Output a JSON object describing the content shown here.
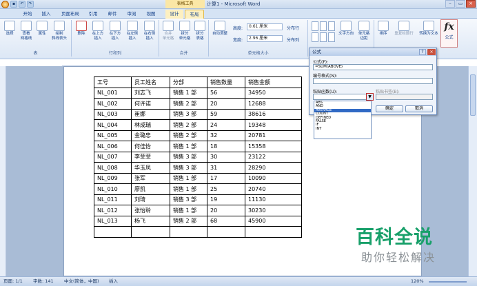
{
  "window": {
    "title": "计算1 - Microsoft Word",
    "context_tool": "表格工具"
  },
  "tabs": [
    "开始",
    "插入",
    "页面布局",
    "引用",
    "邮件",
    "审阅",
    "视图",
    "设计",
    "布局"
  ],
  "ribbon": {
    "buttons": {
      "select": "选择",
      "gridlines": "查看\n网格线",
      "properties": "属性",
      "draw_diagonal": "绘制\n斜线表头",
      "delete": "删除",
      "insert_above": "在上方\n插入",
      "insert_below": "在下方\n插入",
      "insert_left": "在左侧\n插入",
      "insert_right": "在右侧\n插入",
      "merge_cells": "合并\n单元格",
      "split_cells": "拆分\n单元格",
      "split_table": "拆分\n表格",
      "autofit": "自动调整",
      "text_direction": "文字方向",
      "cell_margins": "单元格\n边距",
      "sort": "排序",
      "repeat_header": "重复标题行",
      "convert_to_text": "转换为文本",
      "formula": "公式"
    },
    "height_label": "高度:",
    "height_value": "0.61 厘米",
    "width_label": "宽度:",
    "width_value": "2.96 厘米",
    "distribute_rows": "分布行",
    "distribute_cols": "分布列",
    "groups": {
      "table": "表",
      "rows_cols": "行和列",
      "merge": "合并",
      "cell_size": "单元格大小"
    }
  },
  "table": {
    "headers": [
      "工号",
      "员工姓名",
      "分部",
      "销售数量",
      "销售金额"
    ],
    "rows": [
      [
        "NL_001",
        "刘志飞",
        "销售 1 部",
        "56",
        "34950"
      ],
      [
        "NL_002",
        "何许诺",
        "销售 2 部",
        "20",
        "12688"
      ],
      [
        "NL_003",
        "崔娜",
        "销售 3 部",
        "59",
        "38616"
      ],
      [
        "NL_004",
        "林成瑞",
        "销售 2 部",
        "24",
        "19348"
      ],
      [
        "NL_005",
        "金璐忠",
        "销售 2 部",
        "32",
        "20781"
      ],
      [
        "NL_006",
        "何佳怡",
        "销售 1 部",
        "18",
        "15358"
      ],
      [
        "NL_007",
        "李菲菲",
        "销售 3 部",
        "30",
        "23122"
      ],
      [
        "NL_008",
        "华玉凤",
        "销售 3 部",
        "31",
        "28290"
      ],
      [
        "NL_009",
        "张军",
        "销售 1 部",
        "17",
        "10090"
      ],
      [
        "NL_010",
        "廖凯",
        "销售 1 部",
        "25",
        "20740"
      ],
      [
        "NL_011",
        "刘琦",
        "销售 3 部",
        "19",
        "11130"
      ],
      [
        "NL_012",
        "张怡聆",
        "销售 1 部",
        "20",
        "30230"
      ],
      [
        "NL_013",
        "杨飞",
        "销售 2 部",
        "68",
        "45900"
      ],
      [
        "",
        "",
        "",
        "",
        ""
      ]
    ]
  },
  "dialog": {
    "title": "公式",
    "help": "?",
    "close": "×",
    "formula_label": "公式(F):",
    "formula_value": "=SUM(ABOVE)",
    "number_format_label": "编号格式(N):",
    "number_format_value": "",
    "paste_function_label": "粘贴函数(U):",
    "paste_bookmark_label": "粘贴书签(B):",
    "ok": "确定",
    "cancel": "取消",
    "function_list": [
      "ABS",
      "AND",
      "AVERAGE",
      "COUNT",
      "DEFINED",
      "FALSE",
      "IF",
      "INT"
    ],
    "selected_function": "AVERAGE"
  },
  "status": {
    "page": "页面: 1/1",
    "words": "字数: 141",
    "language": "中文(简体，中国)",
    "mode": "插入",
    "zoom": "120%"
  },
  "watermark": {
    "title": "百科全说",
    "subtitle": "助你轻松解决"
  }
}
